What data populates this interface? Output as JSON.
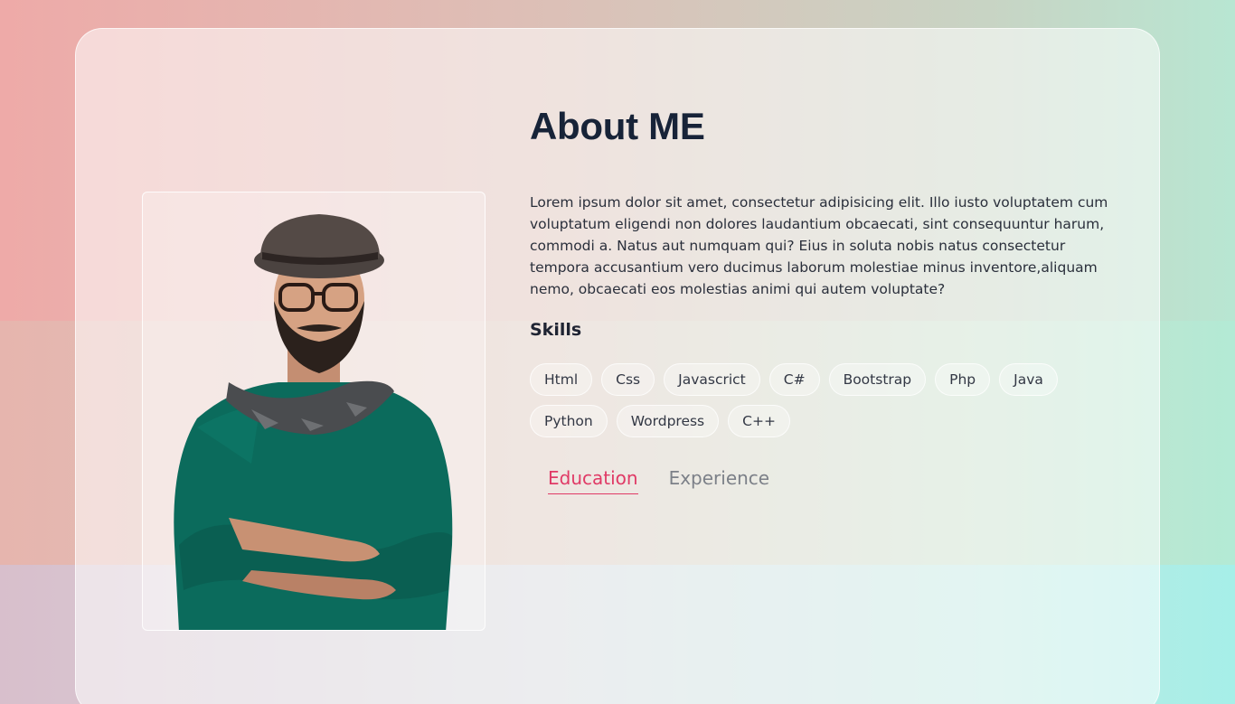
{
  "about": {
    "title": "About ME",
    "bio": "Lorem ipsum dolor sit amet, consectetur adipisicing elit. Illo iusto voluptatem cum voluptatum eligendi non dolores laudantium obcaecati, sint consequuntur harum, commodi a. Natus aut numquam qui? Eius in soluta nobis natus consectetur tempora accusantium vero ducimus laborum molestiae minus inventore,aliquam nemo, obcaecati eos molestias animi qui autem voluptate?",
    "skills_heading": "Skills",
    "skills": [
      "Html",
      "Css",
      "Javascrict",
      "C#",
      "Bootstrap",
      "Php",
      "Java",
      "Python",
      "Wordpress",
      "C++"
    ],
    "tabs": [
      {
        "label": "Education",
        "active": true
      },
      {
        "label": "Experience",
        "active": false
      }
    ]
  },
  "colors": {
    "accent": "#e03a66",
    "heading": "#172338",
    "sweater": "#0b6b5c"
  },
  "profile_photo": {
    "icon": "person-portrait"
  }
}
